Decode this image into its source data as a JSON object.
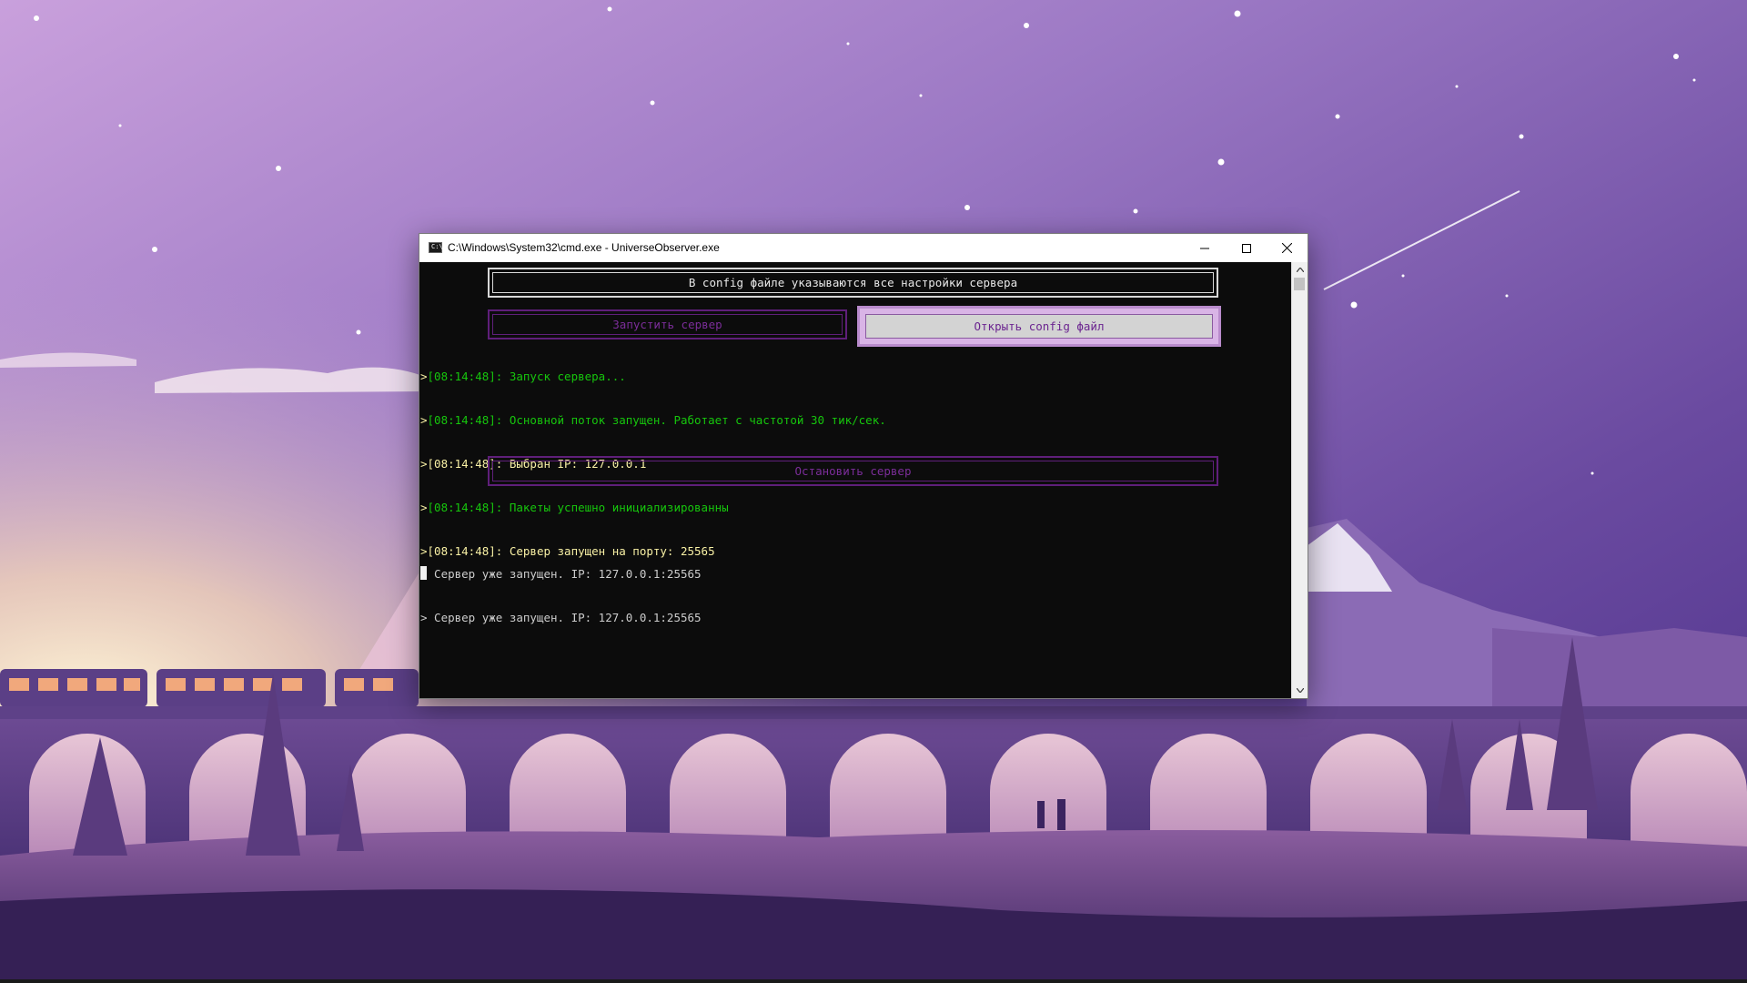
{
  "window": {
    "title": "C:\\Windows\\System32\\cmd.exe - UniverseObserver.exe",
    "icon_label": "C:\\"
  },
  "console": {
    "info_text": "В config файле указываются все настройки сервера",
    "start_button": "Запустить сервер",
    "config_button": "Открыть config файл",
    "stop_button": "Остановить сервер",
    "log": [
      {
        "prefix": ">",
        "text": "[08:14:48]: Запуск сервера...",
        "color": "#16c60c"
      },
      {
        "prefix": ">",
        "text": "[08:14:48]: Основной поток запущен. Работает с частотой 30 тик/сек.",
        "color": "#16c60c"
      },
      {
        "prefix": ">",
        "text": "[08:14:48]: Выбран IP: 127.0.0.1",
        "color": "#f9f1a5"
      },
      {
        "prefix": ">",
        "text": "[08:14:48]: Пакеты успешно инициализированны",
        "color": "#16c60c"
      },
      {
        "prefix": ">",
        "text": "[08:14:48]: Сервер запущен на порту: 25565",
        "color": "#f9f1a5"
      }
    ],
    "echo": [
      "> Сервер уже запущен. IP: 127.0.0.1:25565",
      "> Сервер уже запущен. IP: 127.0.0.1:25565"
    ]
  },
  "icons": {
    "minimize": "minimize-icon",
    "maximize": "maximize-icon",
    "close": "close-icon",
    "scroll_up": "scroll-up-arrow-icon",
    "scroll_down": "scroll-down-arrow-icon"
  },
  "colors": {
    "accent_purple": "#7b2d99",
    "log_green": "#16c60c",
    "log_yellow": "#f9f1a5"
  }
}
